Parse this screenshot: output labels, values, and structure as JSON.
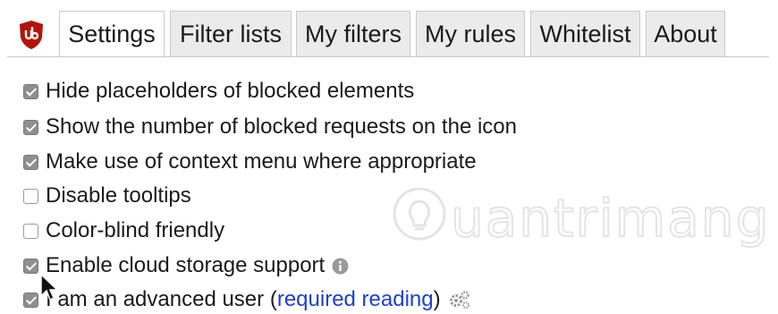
{
  "tabs": [
    {
      "label": "Settings",
      "active": true
    },
    {
      "label": "Filter lists",
      "active": false
    },
    {
      "label": "My filters",
      "active": false
    },
    {
      "label": "My rules",
      "active": false
    },
    {
      "label": "Whitelist",
      "active": false
    },
    {
      "label": "About",
      "active": false
    }
  ],
  "settings": [
    {
      "label": "Hide placeholders of blocked elements",
      "checked": true
    },
    {
      "label": "Show the number of blocked requests on the icon",
      "checked": true
    },
    {
      "label": "Make use of context menu where appropriate",
      "checked": true
    },
    {
      "label": "Disable tooltips",
      "checked": false
    },
    {
      "label": "Color-blind friendly",
      "checked": false
    },
    {
      "label": "Enable cloud storage support",
      "checked": true,
      "icon": "info-icon"
    },
    {
      "label": "I am an advanced user",
      "checked": true,
      "paren_open": " (",
      "link": "required reading",
      "paren_close": ")",
      "icon": "gear-icon"
    }
  ],
  "watermark": {
    "text": "uantrimang"
  },
  "colors": {
    "logo": "#b2140b",
    "link": "#1a3fd6",
    "checkbox_on": "#8f8f8f"
  }
}
